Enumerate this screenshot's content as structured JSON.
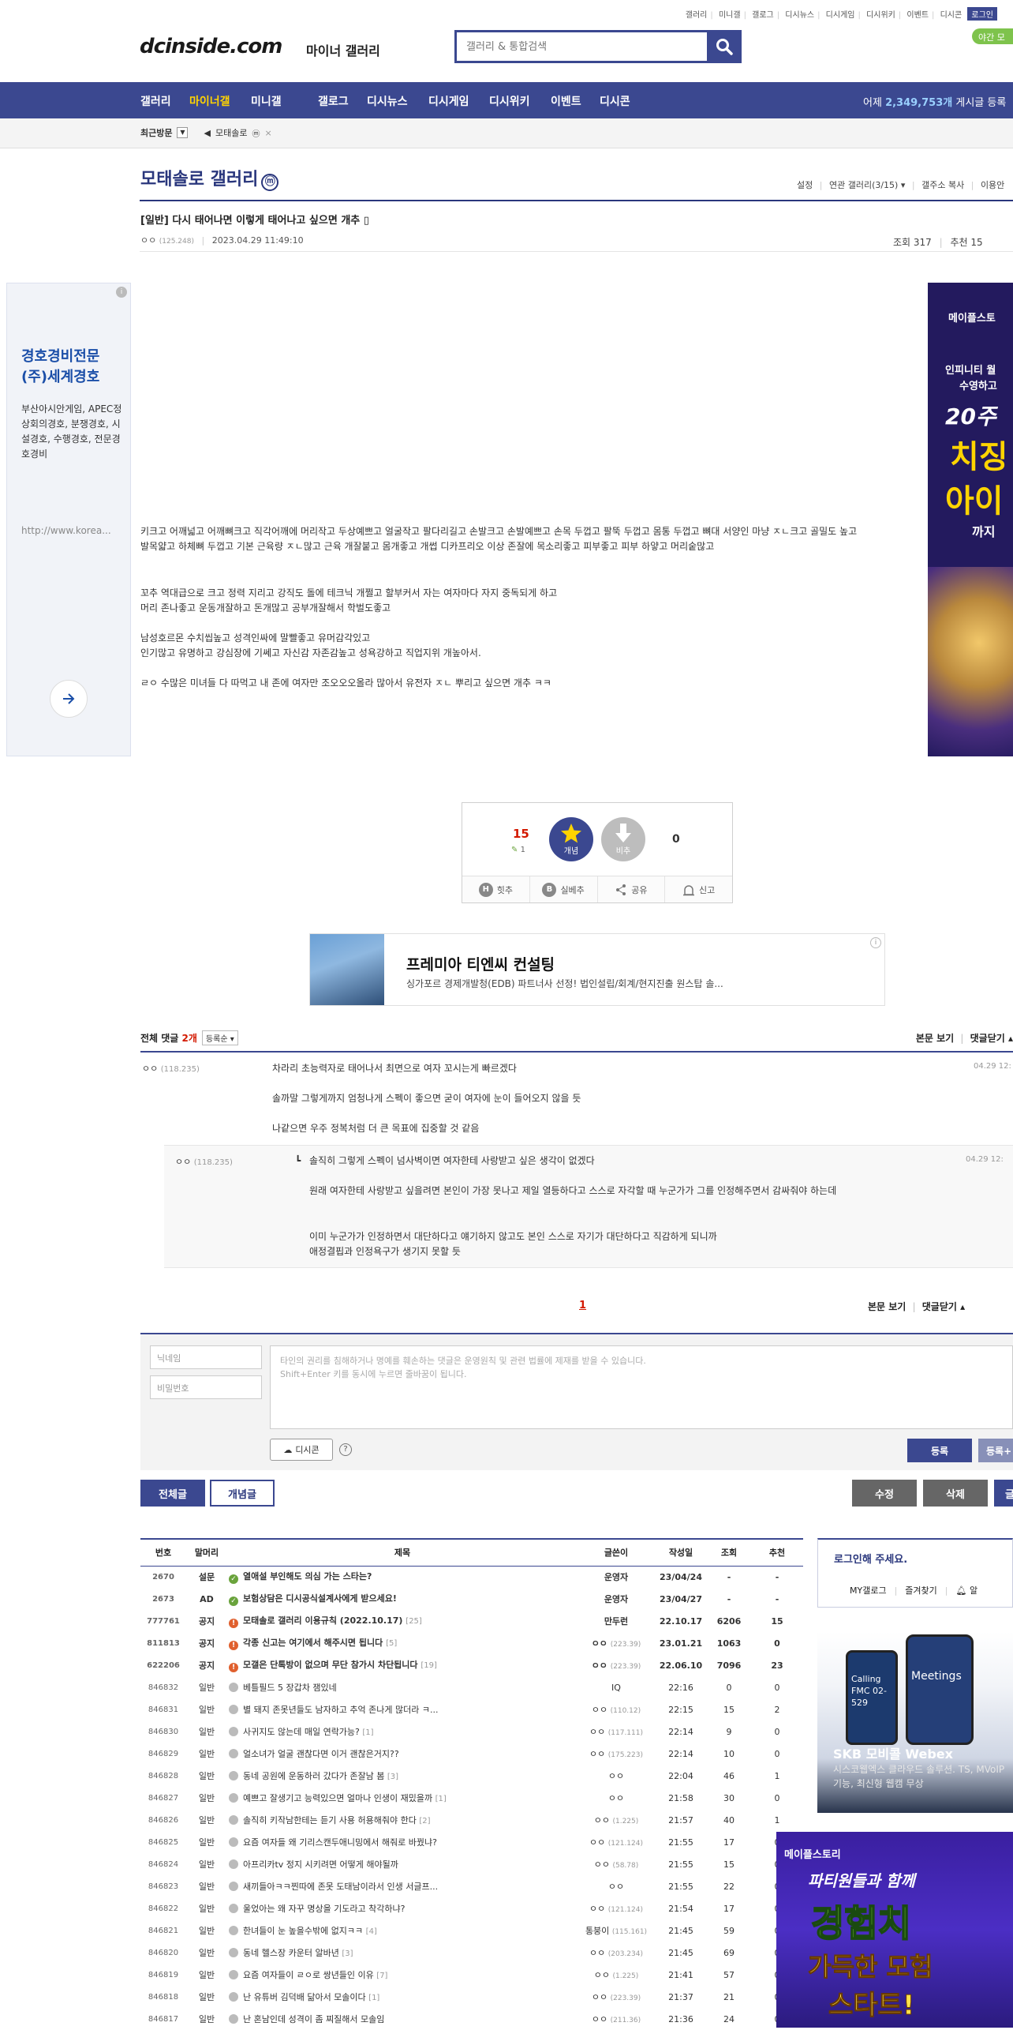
{
  "header": {
    "top_links": [
      "갤러리",
      "미니갤",
      "갤로그",
      "디시뉴스",
      "디시게임",
      "디시위키",
      "이벤트",
      "디시콘"
    ],
    "login_label": "로그인",
    "green_pill": "야간 모",
    "logo_text": "dcinside.com",
    "logo_sub": "마이너 갤러리",
    "search_placeholder": "갤러리 & 통합검색",
    "search_icon": "search-icon"
  },
  "gnb": {
    "items": [
      "갤러리",
      "마이너갤",
      "미니갤",
      "갤로그",
      "디시뉴스",
      "디시게임",
      "디시위키",
      "이벤트",
      "디시콘"
    ],
    "stat_prefix": "어제",
    "stat_count": "2,349,753개",
    "stat_suffix": "게시글 등록"
  },
  "crumb": {
    "recent": "최근방문",
    "gallery": "모태솔로"
  },
  "gallery": {
    "title": "모태솔로 갤러리",
    "badge": "ⓜ",
    "menu": [
      "설정",
      "연관 갤러리(3/15)",
      "갤주소 복사",
      "이용안"
    ]
  },
  "post": {
    "title": "[일반] 다시 태어나면 이렇게 태어나고 싶으면 개추",
    "author": "ㅇㅇ",
    "ip": "(125.248)",
    "date": "2023.04.29 11:49:10",
    "views": "조회 317",
    "recs": "추천 15",
    "paragraphs": [
      "키크고 어깨넓고 어깨뼈크고 직각어깨에 머리작고 두상예쁘고 얼굴작고 팔다리길고 손발크고 손발예쁘고 손목 두껍고 팔뚝 두껍고 몸통 두껍고 뼈대 서양인 마냥 ㅈㄴ크고 골밀도 높고 발목얇고 하체뼈 두껍고 기본 근육량 ㅈㄴ많고 근육 개잘붙고 몸개좋고 개썹 디카프리오 이상 존잘에 목소리좋고 피부좋고 피부 하얗고 머리숱많고",
      "꼬추 역대급으로 크고 정력 지리고 강직도 돌에 테크닉 개쩔고 할부커서 자는 여자마다 자지 중독되게 하고",
      "머리 존나좋고 운동개잘하고 돈개많고 공부개잘해서 학벌도좋고",
      "남성호르몬 수치씹높고 성격인싸에 말빨좋고 유머감각있고",
      "인기많고 유명하고 강심장에 기쎄고 자신감 자존감높고 성욕강하고 직업지위 개높아서.",
      "ㄹㅇ 수많은 미녀들 다 따먹고 내 존에 여자만 조오오오올라 많아서 유전자 ㅈㄴ 뿌리고 싶으면 개추 ㅋㅋ"
    ]
  },
  "left_ad": {
    "title": "경호경비전문 (주)세계경호",
    "desc": "부산아시안게임, APEC정상회의경호, 분쟁경호, 시설경호, 수행경호, 전문경호경비",
    "url": "http://www.korea..."
  },
  "right_ad": {
    "brand": "메이플스토",
    "line1": "인피니티 월",
    "line2": "수영하고",
    "line3": "20주",
    "line4": "치징",
    "line5": "아이",
    "line6": "까지"
  },
  "vote": {
    "up_count": "15",
    "up_sub": "1",
    "up_label": "개념",
    "down_label": "비추",
    "down_count": "0",
    "actions": [
      "힛추",
      "실베추",
      "공유",
      "신고"
    ]
  },
  "banner": {
    "title": "프레미아 티엔씨 컨설팅",
    "desc": "싱가포르 경제개발청(EDB) 파트너사 선정! 법인설립/회계/현지진출 원스탑 솔..."
  },
  "comments": {
    "label": "전체 댓글",
    "count": "2개",
    "sort": "등록순",
    "view_label": "본문 보기",
    "close_label": "댓글닫기",
    "items": [
      {
        "nick": "ㅇㅇ",
        "ip": "(118.235)",
        "lines": [
          "차라리 초능력자로 태어나서 최면으로 여자 꼬시는게 빠르겠다",
          "솔까말 그렇게까지 엄청나게 스펙이 좋으면 굳이 여자에 눈이 들어오지 않을 듯",
          "나같으면 우주 정복처럼 더 큰 목표에 집중할 것 같음"
        ],
        "date": "04.29 12:"
      }
    ],
    "reply": {
      "nick": "ㅇㅇ",
      "ip": "(118.235)",
      "lines": [
        "솔직히 그렇게 스펙이 넘사벽이면 여자한테 사랑받고 싶은 생각이 없겠다",
        "원래 여자한테 사랑받고 싶을려면 본인이 가장 못나고 제일 열등하다고 스스로 자각할 때 누군가가 그를 인정해주면서 감싸줘야 하는데",
        "이미 누군가가 인정하면서 대단하다고 얘기하지 않고도 본인 스스로 자기가 대단하다고 직감하게 되니까",
        "애정결핍과 인정욕구가 생기지 못할 듯"
      ],
      "date": "04.29 12:"
    },
    "page": "1"
  },
  "write": {
    "nick_placeholder": "닉네임",
    "pw_placeholder": "비밀번호",
    "ta_line1": "타인의 권리를 침해하거나 명예를 훼손하는 댓글은 운영원칙 및 관련 법률에 제재를 받을 수 있습니다.",
    "ta_line2": "Shift+Enter 키를 동시에 누르면 줄바꿈이 됩니다.",
    "dccon": "디시콘",
    "help": "?",
    "register": "등록",
    "register2": "등록+"
  },
  "buttons": {
    "all": "전체글",
    "concept": "개념글",
    "edit": "수정",
    "delete": "삭제",
    "write": "글"
  },
  "list": {
    "headers": [
      "번호",
      "말머리",
      "제목",
      "글쓴이",
      "작성일",
      "조회",
      "추천"
    ],
    "rows": [
      {
        "num": "2670",
        "head": "설문",
        "icon": "sp",
        "title": "열애설 부인해도 의심 가는 스타는?",
        "cc": "",
        "author": "운영자",
        "ip": "",
        "date": "23/04/24",
        "views": "-",
        "recs": "-",
        "notice": true
      },
      {
        "num": "2673",
        "head": "AD",
        "icon": "sp",
        "title": "보험상담은 디시공식설계사에게 받으세요!",
        "cc": "",
        "author": "운영자",
        "ip": "",
        "date": "23/04/27",
        "views": "-",
        "recs": "-",
        "notice": true
      },
      {
        "num": "777761",
        "head": "공지",
        "icon": "no",
        "title": "모태솔로 갤러리 이용규칙 (2022.10.17)",
        "cc": "[25]",
        "author": "만두런",
        "ip": "",
        "date": "22.10.17",
        "views": "6206",
        "recs": "15",
        "notice": true
      },
      {
        "num": "811813",
        "head": "공지",
        "icon": "no",
        "title": "각종 신고는 여기에서 해주시면 됩니다",
        "cc": "[5]",
        "author": "ㅇㅇ",
        "ip": "(223.39)",
        "date": "23.01.21",
        "views": "1063",
        "recs": "0",
        "notice": true
      },
      {
        "num": "622206",
        "head": "공지",
        "icon": "no",
        "title": "모갤은 단톡방이 없으며 무단 참가시 차단됩니다",
        "cc": "[19]",
        "author": "ㅇㅇ",
        "ip": "(223.39)",
        "date": "22.06.10",
        "views": "7096",
        "recs": "23",
        "notice": true
      },
      {
        "num": "846832",
        "head": "일반",
        "icon": "nm",
        "title": "베틀필드 5 장갑차 잼있네",
        "cc": "",
        "author": "IQ",
        "ip": "",
        "date": "22:16",
        "views": "0",
        "recs": "0",
        "notice": false
      },
      {
        "num": "846831",
        "head": "일반",
        "icon": "nm",
        "title": "별 돼지 존못년들도 남자하고 추억 존나게 많더라 ㅋ...",
        "cc": "",
        "author": "ㅇㅇ",
        "ip": "(110.12)",
        "date": "22:15",
        "views": "15",
        "recs": "2",
        "notice": false
      },
      {
        "num": "846830",
        "head": "일반",
        "icon": "nm",
        "title": "사귀지도 않는데 매일 연락가능?",
        "cc": "[1]",
        "author": "ㅇㅇ",
        "ip": "(117.111)",
        "date": "22:14",
        "views": "9",
        "recs": "0",
        "notice": false
      },
      {
        "num": "846829",
        "head": "일반",
        "icon": "nm",
        "title": "얼소녀가 얼굴 괜찮다면 이거 괜찮은거지??",
        "cc": "",
        "author": "ㅇㅇ",
        "ip": "(175.223)",
        "date": "22:14",
        "views": "10",
        "recs": "0",
        "notice": false
      },
      {
        "num": "846828",
        "head": "일반",
        "icon": "nm",
        "title": "동네 공원에 운동하러 갔다가 존잘남 봄",
        "cc": "[3]",
        "author": "ㅇㅇ",
        "ip": "",
        "date": "22:04",
        "views": "46",
        "recs": "1",
        "notice": false
      },
      {
        "num": "846827",
        "head": "일반",
        "icon": "nm",
        "title": "예쁘고 잘생기고 능력있으면 얼마나 인생이 재밌을까",
        "cc": "[1]",
        "author": "ㅇㅇ",
        "ip": "",
        "date": "21:58",
        "views": "30",
        "recs": "0",
        "notice": false
      },
      {
        "num": "846826",
        "head": "일반",
        "icon": "nm",
        "title": "솔직히 키작남한테는 듣기 사용 허용해줘야 한다",
        "cc": "[2]",
        "author": "ㅇㅇ",
        "ip": "(1.225)",
        "date": "21:57",
        "views": "40",
        "recs": "1",
        "notice": false
      },
      {
        "num": "846825",
        "head": "일반",
        "icon": "nm",
        "title": "요즘 여자들 왜 기리스캔두애니밍에서 해줘로 바꿨냐?",
        "cc": "",
        "author": "ㅇㅇ",
        "ip": "(121.124)",
        "date": "21:55",
        "views": "17",
        "recs": "0",
        "notice": false
      },
      {
        "num": "846824",
        "head": "일반",
        "icon": "nm",
        "title": "아프리카tv 정지 시키려면 어떻게 해야될까",
        "cc": "",
        "author": "ㅇㅇ",
        "ip": "(58.78)",
        "date": "21:55",
        "views": "15",
        "recs": "0",
        "notice": false
      },
      {
        "num": "846823",
        "head": "일반",
        "icon": "nm",
        "title": "새끼들아ㅋㅋ찐따에 존못 도태남이라서 인생 서글프...",
        "cc": "",
        "author": "ㅇㅇ",
        "ip": "",
        "date": "21:55",
        "views": "22",
        "recs": "0",
        "notice": false
      },
      {
        "num": "846822",
        "head": "일반",
        "icon": "nm",
        "title": "울었아는 왜 자꾸 명상을 기도라고 착각하냐?",
        "cc": "",
        "author": "ㅇㅇ",
        "ip": "(121.124)",
        "date": "21:54",
        "views": "17",
        "recs": "0",
        "notice": false
      },
      {
        "num": "846821",
        "head": "일반",
        "icon": "nm",
        "title": "한녀들이 눈 높을수밖에 없지ㅋㅋ",
        "cc": "[4]",
        "author": "통붕이",
        "ip": "(115.161)",
        "date": "21:45",
        "views": "59",
        "recs": "0",
        "notice": false
      },
      {
        "num": "846820",
        "head": "일반",
        "icon": "nm",
        "title": "동네 헬스장 카운터 알바년",
        "cc": "[3]",
        "author": "ㅇㅇ",
        "ip": "(203.234)",
        "date": "21:45",
        "views": "69",
        "recs": "0",
        "notice": false
      },
      {
        "num": "846819",
        "head": "일반",
        "icon": "nm",
        "title": "요즘 여자들이 ㄹㅇ로 쌍년들인 이유",
        "cc": "[7]",
        "author": "ㅇㅇ",
        "ip": "(1.225)",
        "date": "21:41",
        "views": "57",
        "recs": "0",
        "notice": false
      },
      {
        "num": "846818",
        "head": "일반",
        "icon": "nm",
        "title": "난 유튜버 김덕배 닮아서 모솔이다",
        "cc": "[1]",
        "author": "ㅇㅇ",
        "ip": "(223.39)",
        "date": "21:37",
        "views": "21",
        "recs": "0",
        "notice": false
      },
      {
        "num": "846817",
        "head": "일반",
        "icon": "nm",
        "title": "난 혼남인데 성격이 좀 찌질해서 모솔임",
        "cc": "",
        "author": "ㅇㅇ",
        "ip": "(211.36)",
        "date": "21:36",
        "views": "24",
        "recs": "0",
        "notice": false
      }
    ]
  },
  "login_panel": {
    "title": "로그인해 주세요.",
    "links": [
      "MY갤로그",
      "즐겨찾기",
      "알"
    ]
  },
  "skb_ad": {
    "phone1": "Calling FMC 02-529",
    "phone2": "Meetings",
    "title": "SKB 모비콜 Webex",
    "desc": "시스코웹엑스 클라우드 솔루션. TS, MVoIP 기능, 최신형 웹캠 무상"
  },
  "maple_ad": {
    "brand": "메이플스토리",
    "line1": "파티원들과 함께",
    "line2": "경험치",
    "line3": "가득한 모험",
    "line4": "스타트!"
  },
  "colors": {
    "brand": "#3b4890",
    "accent_yellow": "#ffd400",
    "red": "#d31900"
  }
}
